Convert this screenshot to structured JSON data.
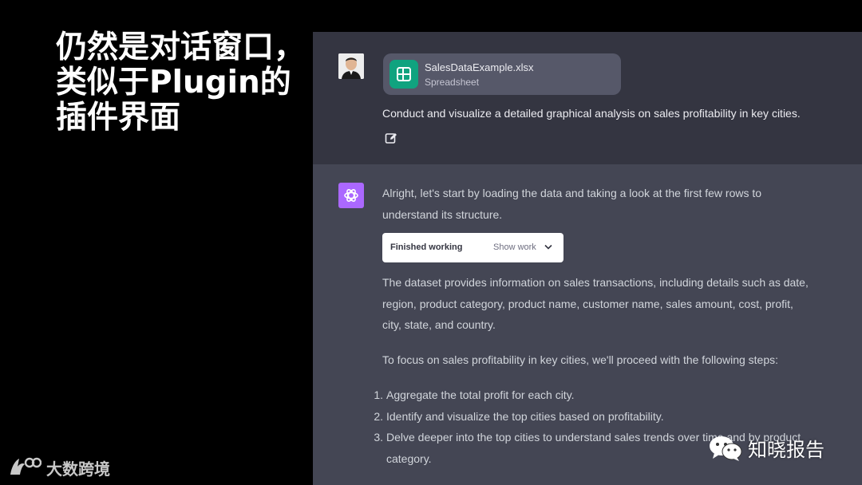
{
  "slide": {
    "headline_lines": [
      "仍然是对话窗口，",
      "类似于Plugin的",
      "插件界面"
    ]
  },
  "brand_bottom_left": {
    "icon": "bird-logo-icon",
    "text": "大数跨境"
  },
  "watermark": {
    "icon": "wechat-icon",
    "text": "知晓报告"
  },
  "chat": {
    "user": {
      "avatar_icon": "user-avatar-photo",
      "attachment": {
        "icon": "spreadsheet-icon",
        "name": "SalesDataExample.xlsx",
        "type": "Spreadsheet"
      },
      "message": "Conduct and visualize a detailed graphical analysis on sales profitability in key cities.",
      "edit_icon": "edit-icon"
    },
    "assistant": {
      "avatar_icon": "openai-logo-icon",
      "intro_line1": "Alright, let's start by loading the data and taking a look at the first few rows to",
      "intro_line2": "understand its structure.",
      "tool_status": {
        "label": "Finished working",
        "show_work": "Show work",
        "icon": "chevron-down-icon"
      },
      "dataset_lines": [
        "The dataset provides information on sales transactions, including details such as date,",
        "region, product category, product name, customer name, sales amount, cost, profit,",
        "city, state, and country."
      ],
      "steps_intro": "To focus on sales profitability in key cities, we'll proceed with the following steps:",
      "steps": [
        {
          "num": "1.",
          "text": "Aggregate the total profit for each city."
        },
        {
          "num": "2.",
          "text": "Identify and visualize the top cities based on profitability."
        },
        {
          "num": "3.",
          "text": "Delve deeper into the top cities to understand sales trends over time and by product",
          "text2": "category."
        }
      ]
    }
  },
  "colors": {
    "assistant_bg": "#444654",
    "user_bg": "#343541",
    "attachment_bg": "#565869",
    "spreadsheet_green": "#10a37f",
    "gpt_purple": "#ab68ff"
  }
}
